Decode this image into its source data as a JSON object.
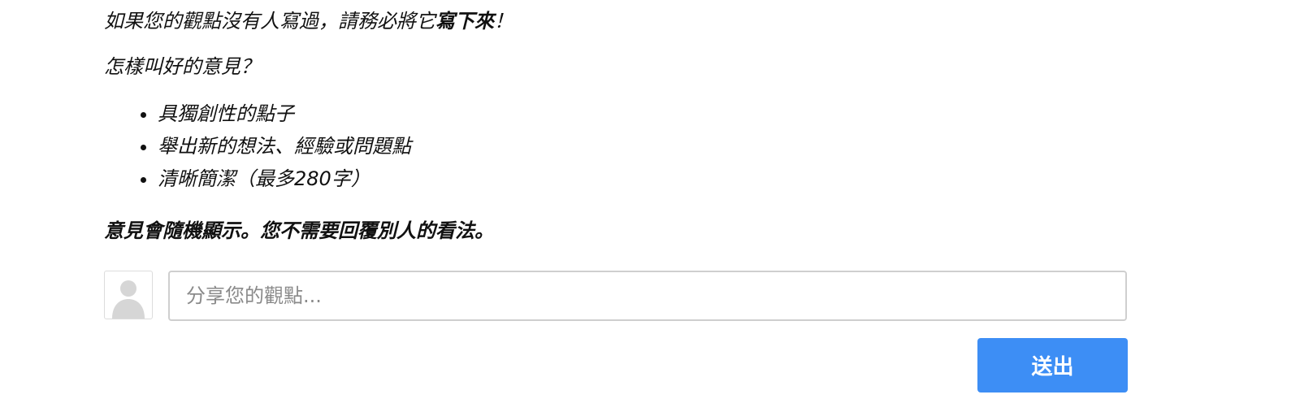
{
  "intro": {
    "prefix": "如果您的觀點沒有人寫過，請務必將它",
    "emphasis": "寫下來",
    "suffix": "！"
  },
  "question": "怎樣叫好的意見？",
  "points": [
    "具獨創性的點子",
    "舉出新的想法、經驗或問題點",
    "清晰簡潔（最多280字）"
  ],
  "note": "意見會隨機顯示。您不需要回覆別人的看法。",
  "composer": {
    "avatar_icon": "user-silhouette-icon",
    "placeholder": "分享您的觀點...",
    "value": "",
    "submit_label": "送出"
  },
  "colors": {
    "accent": "#3d8ef5",
    "border": "#cfcfcf",
    "avatar_fill": "#d6d6d6"
  }
}
